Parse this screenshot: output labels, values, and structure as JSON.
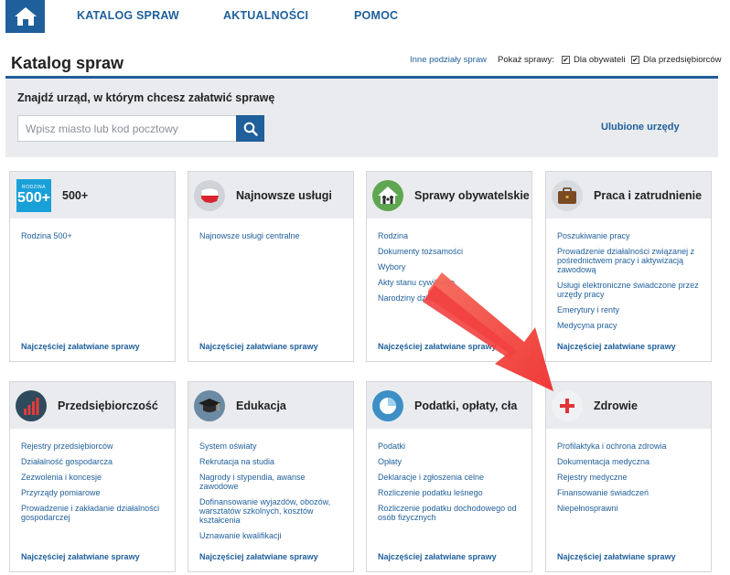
{
  "nav": {
    "links": [
      "KATALOG SPRAW",
      "AKTUALNOŚCI",
      "POMOC"
    ]
  },
  "header": {
    "title": "Katalog spraw",
    "other_link": "Inne podziały spraw",
    "show_label": "Pokaż sprawy:",
    "checkboxes": [
      "Dla obywateli",
      "Dla przedsiębiorców"
    ]
  },
  "search": {
    "heading": "Znajdź urząd, w którym chcesz załatwić sprawę",
    "placeholder": "Wpisz miasto lub kod pocztowy",
    "favorites": "Ulubione urzędy"
  },
  "logo_500": {
    "top": "RODZINA",
    "number": "500+"
  },
  "cards": [
    {
      "title": "500+",
      "icon": "rodzina-500-icon",
      "items": [
        "Rodzina 500+"
      ],
      "footer": "Najczęściej załatwiane sprawy"
    },
    {
      "title": "Najnowsze usługi",
      "icon": "poland-map-icon",
      "items": [
        "Najnowsze usługi centralne"
      ],
      "footer": "Najczęściej załatwiane sprawy"
    },
    {
      "title": "Sprawy obywatelskie",
      "icon": "family-house-icon",
      "items": [
        "Rodzina",
        "Dokumenty tożsamości",
        "Wybory",
        "Akty stanu cywilnego",
        "Narodziny dziecka"
      ],
      "footer": "Najczęściej załatwiane sprawy"
    },
    {
      "title": "Praca i zatrudnienie",
      "icon": "briefcase-icon",
      "items": [
        "Poszukiwanie pracy",
        "Prowadzenie działalności związanej z pośrednictwem pracy i aktywizacją zawodową",
        "Usługi elektroniczne świadczone przez urzędy pracy",
        "Emerytury i renty",
        "Medycyna pracy"
      ],
      "footer": "Najczęściej załatwiane sprawy"
    },
    {
      "title": "Przedsiębiorczość",
      "icon": "bar-chart-icon",
      "items": [
        "Rejestry przedsiębiorców",
        "Działalność gospodarcza",
        "Zezwolenia i koncesje",
        "Przyrządy pomiarowe",
        "Prowadzenie i zakładanie działalności gospodarczej"
      ],
      "footer": "Najczęściej załatwiane sprawy"
    },
    {
      "title": "Edukacja",
      "icon": "graduation-cap-icon",
      "items": [
        "System oświaty",
        "Rekrutacja na studia",
        "Nagrody i stypendia, awanse zawodowe",
        "Dofinansowanie wyjazdów, obozów, warsztatów szkolnych, kosztów kształcenia",
        "Uznawanie kwalifikacji"
      ],
      "footer": "Najczęściej załatwiane sprawy"
    },
    {
      "title": "Podatki, opłaty, cła",
      "icon": "pie-chart-icon",
      "items": [
        "Podatki",
        "Opłaty",
        "Deklaracje i zgłoszenia celne",
        "Rozliczenie podatku leśnego",
        "Rozliczenie podatku dochodowego od osób fizycznych"
      ],
      "footer": "Najczęściej załatwiane sprawy"
    },
    {
      "title": "Zdrowie",
      "icon": "red-cross-icon",
      "items": [
        "Profilaktyka i ochrona zdrowia",
        "Dokumentacja medyczna",
        "Rejestry medyczne",
        "Finansowanie świadczeń",
        "Niepełnosprawni"
      ],
      "footer": "Najczęściej załatwiane sprawy"
    }
  ],
  "colors": {
    "brand_blue": "#1f5f9b",
    "panel_gray": "#e9ebee",
    "annotation_arrow": "#f03a3a"
  }
}
